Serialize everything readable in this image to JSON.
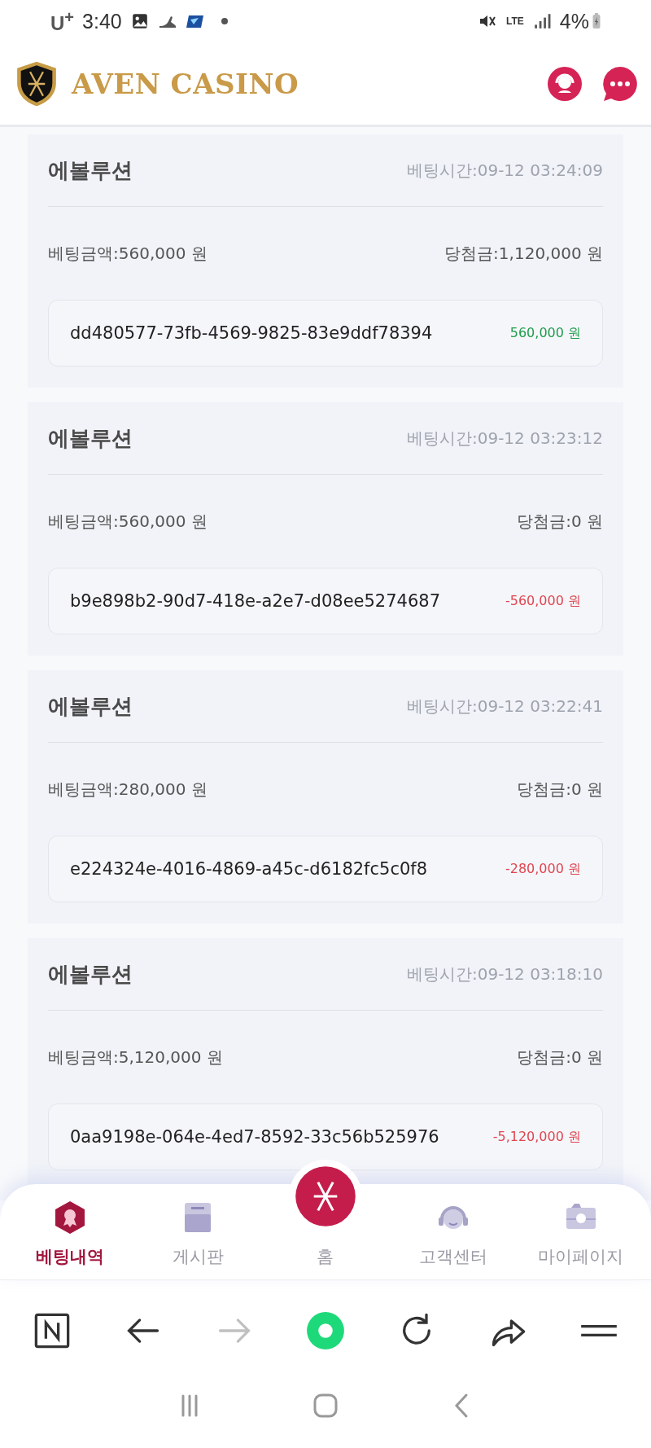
{
  "status_bar": {
    "carrier": "U$^{+}$",
    "time": "3:40",
    "network": "LTE",
    "battery": "4%"
  },
  "header": {
    "title": "AVEN CASINO"
  },
  "bets": [
    {
      "game": "에볼루션",
      "time": "베팅시간:09-12 03:24:09",
      "stake": "베팅금액:560,000 원",
      "payout": "당첨금:1,120,000 원",
      "bet_id": "dd480577-73fb-4569-9825-83e9ddf78394",
      "result": "560,000 원",
      "color": "#1f9d4c"
    },
    {
      "game": "에볼루션",
      "time": "베팅시간:09-12 03:23:12",
      "stake": "베팅금액:560,000 원",
      "payout": "당첨금:0 원",
      "bet_id": "b9e898b2-90d7-418e-a2e7-d08ee5274687",
      "result": "-560,000 원",
      "color": "#e04650"
    },
    {
      "game": "에볼루션",
      "time": "베팅시간:09-12 03:22:41",
      "stake": "베팅금액:280,000 원",
      "payout": "당첨금:0 원",
      "bet_id": "e224324e-4016-4869-a45c-d6182fc5c0f8",
      "result": "-280,000 원",
      "color": "#e04650"
    },
    {
      "game": "에볼루션",
      "time": "베팅시간:09-12 03:18:10",
      "stake": "베팅금액:5,120,000 원",
      "payout": "당첨금:0 원",
      "bet_id": "0aa9198e-064e-4ed7-8592-33c56b525976",
      "result": "-5,120,000 원",
      "color": "#e04650"
    }
  ],
  "bottom_nav": [
    {
      "kind": "history",
      "label": "베팅내역",
      "selected": true
    },
    {
      "kind": "board",
      "label": "게시판",
      "selected": false
    },
    {
      "kind": "home",
      "label": "홈",
      "selected": false
    },
    {
      "kind": "support",
      "label": "고객센터",
      "selected": false
    },
    {
      "kind": "mypage",
      "label": "마이페이지",
      "selected": false
    }
  ],
  "browser_toolbar": [
    {
      "kind": "naver",
      "disabled": false
    },
    {
      "kind": "back",
      "disabled": false
    },
    {
      "kind": "forward",
      "disabled": true
    },
    {
      "kind": "green",
      "disabled": false
    },
    {
      "kind": "reload",
      "disabled": false
    },
    {
      "kind": "share",
      "disabled": false
    },
    {
      "kind": "menu",
      "disabled": false
    }
  ]
}
